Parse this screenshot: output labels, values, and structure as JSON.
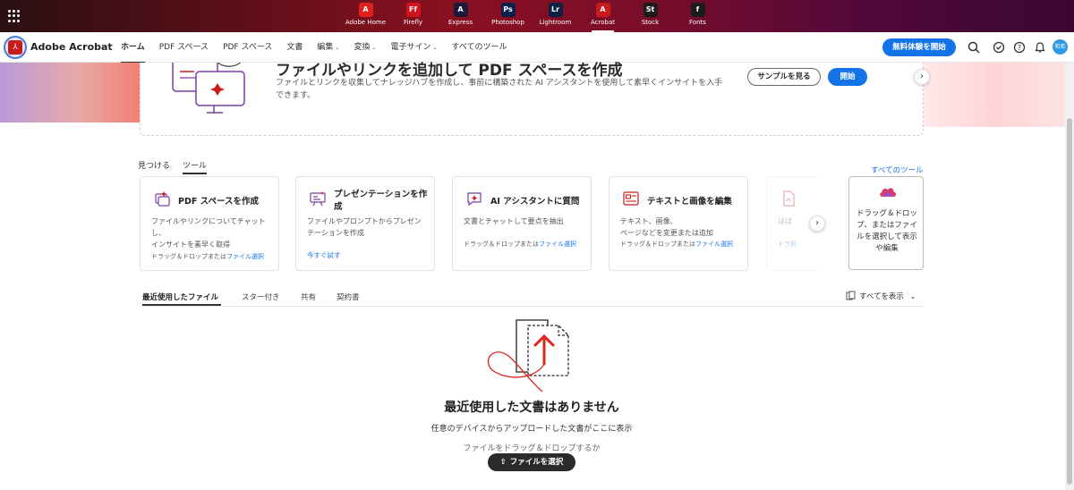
{
  "app_bar": {
    "apps": [
      {
        "label": "Adobe Home",
        "logo": "A",
        "color": "#e0201b",
        "icon": "adobe-home-icon"
      },
      {
        "label": "Firefly",
        "logo": "Ff",
        "color": "#d3121e",
        "icon": "firefly-icon"
      },
      {
        "label": "Express",
        "logo": "A",
        "color": "#1a1a3a",
        "icon": "express-icon"
      },
      {
        "label": "Photoshop",
        "logo": "Ps",
        "color": "#0c1f4a",
        "icon": "photoshop-icon"
      },
      {
        "label": "Lightroom",
        "logo": "Lr",
        "color": "#0c2244",
        "icon": "lightroom-icon"
      },
      {
        "label": "Acrobat",
        "logo": "A",
        "color": "#c91b1b",
        "icon": "acrobat-icon"
      },
      {
        "label": "Stock",
        "logo": "St",
        "color": "#1c1c1c",
        "icon": "stock-icon"
      },
      {
        "label": "Fonts",
        "logo": "f",
        "color": "#1c1c1c",
        "icon": "fonts-icon"
      }
    ],
    "active_app": "Acrobat"
  },
  "nav": {
    "brand": "Adobe Acrobat",
    "items": [
      {
        "label": "ホーム",
        "active": true,
        "caret": false
      },
      {
        "label": "PDF スペース",
        "active": false,
        "caret": false
      },
      {
        "label": "PDF スペース",
        "active": false,
        "caret": false
      },
      {
        "label": "文書",
        "active": false,
        "caret": false
      },
      {
        "label": "編集",
        "active": false,
        "caret": true
      },
      {
        "label": "変換",
        "active": false,
        "caret": true
      },
      {
        "label": "電子サイン",
        "active": false,
        "caret": true
      },
      {
        "label": "すべてのツール",
        "active": false,
        "caret": false
      }
    ],
    "trial_button": "無料体験を開始",
    "avatar_text": "和希"
  },
  "banner": {
    "title": "ファイルやリンクを追加して PDF スペースを作成",
    "description": "ファイルとリンクを収集してナレッジハブを作成し、事前に構築された AI アシスタントを使用して素早くインサイトを入手できます。",
    "sample_button": "サンプルを見る",
    "start_button": "開始"
  },
  "tools": {
    "tabs": [
      "見つける",
      "ツール"
    ],
    "active_tab": "ツール",
    "all_tools_link": "すべてのツール",
    "cards": [
      {
        "title": "PDF スペースを作成",
        "description": "ファイルやリンクについてチャットし、\nインサイトを素早く取得",
        "action_prefix": "ドラッグ＆ドロップまたは",
        "action_link": "ファイル選択",
        "icon": "pdf-space-icon"
      },
      {
        "title": "プレゼンテーションを作成",
        "description": "ファイルやプロンプトからプレゼンテーションを作成",
        "link": "今すぐ試す",
        "icon": "presentation-icon"
      },
      {
        "title": "AI アシスタントに質問",
        "description": "文書とチャットして要点を抽出",
        "action_prefix": "ドラッグ＆ドロップまたは",
        "action_link": "ファイル選択",
        "icon": "ai-assistant-icon"
      },
      {
        "title": "テキストと画像を編集",
        "description": "テキスト、画像、\nページなどを変更または追加",
        "action_prefix": "ドラッグ＆ドロップまたは",
        "action_link": "ファイル選択",
        "icon": "edit-text-image-icon"
      }
    ],
    "faded_card": {
      "description": "ほば",
      "action_prefix": "ドラ",
      "action_link": "択",
      "icon": "pdf-icon"
    },
    "drop_card": {
      "text": "ドラッグ＆ドロップ、またはファイルを選択して表示や編集",
      "icon": "cloud-upload-icon"
    }
  },
  "files": {
    "tabs": [
      "最近使用したファイル",
      "スター付き",
      "共有",
      "契約書"
    ],
    "active_tab": "最近使用したファイル",
    "view_all": "すべてを表示",
    "empty_title": "最近使用した文書はありません",
    "empty_description": "任意のデバイスからアップロードした文書がここに表示",
    "drag_text": "ファイルをドラッグ＆ドロップするか",
    "select_button": "ファイルを選択"
  }
}
